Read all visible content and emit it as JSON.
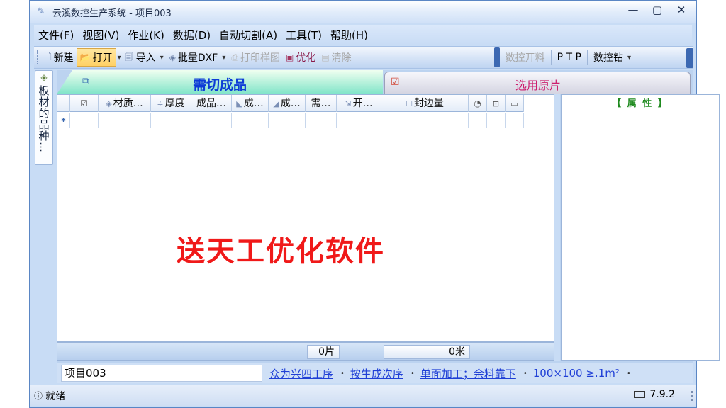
{
  "window": {
    "title": "云溪数控生产系统 - 项目003"
  },
  "menu": [
    "文件(F)",
    "视图(V)",
    "作业(K)",
    "数据(D)",
    "自动切割(A)",
    "工具(T)",
    "帮助(H)"
  ],
  "toolbar": {
    "new_label": "新建",
    "open_label": "打开",
    "import_label": "导入",
    "batch_dxf_label": "批量DXF",
    "print_label": "打印样图",
    "optimize_label": "优化",
    "clear_label": "清除",
    "cnc_cut_label": "数控开料",
    "ptp_label": "P T P",
    "cnc_drill_label": "数控钻"
  },
  "side_tab": {
    "label": "板材的品种…"
  },
  "tabs": {
    "active": "需切成品",
    "inactive": "选用原片"
  },
  "grid": {
    "columns": [
      "材质…",
      "厚度",
      "成品…",
      "成…",
      "成…",
      "需…",
      "开…",
      "封边量"
    ]
  },
  "watermark": "送天工优化软件",
  "footer": {
    "pieces": "0片",
    "meters": "0米"
  },
  "props": {
    "title": "【 属  性 】"
  },
  "bottom": {
    "project": "项目003",
    "process": "众为兴四工序",
    "order": "按生成次序",
    "mode": "单面加工；余料靠下",
    "size": "100×100 ≥.1m²"
  },
  "status": {
    "text": "就绪",
    "version": "7.9.2"
  }
}
